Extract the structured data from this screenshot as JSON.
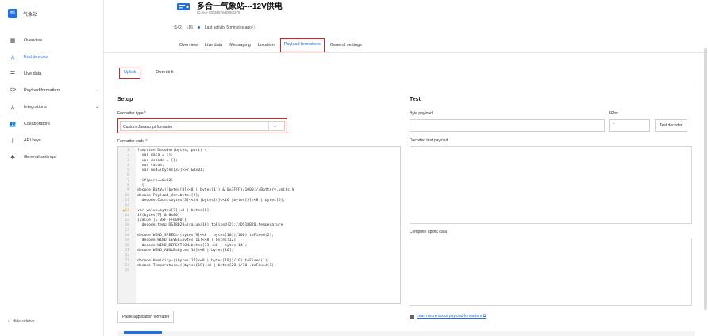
{
  "brand": {
    "name": "气象站"
  },
  "sidebar": {
    "items": [
      {
        "label": "Overview",
        "icon": "grid-icon",
        "glyph": "▦"
      },
      {
        "label": "End devices",
        "icon": "devices-icon",
        "glyph": "⅄"
      },
      {
        "label": "Live data",
        "icon": "list-icon",
        "glyph": "☰"
      },
      {
        "label": "Payload formatters",
        "icon": "code-icon",
        "glyph": "<>"
      },
      {
        "label": "Integrations",
        "icon": "integrations-icon",
        "glyph": "⅄"
      },
      {
        "label": "Collaborators",
        "icon": "people-icon",
        "glyph": "👥"
      },
      {
        "label": "API keys",
        "icon": "key-icon",
        "glyph": "⚷"
      },
      {
        "label": "General settings",
        "icon": "gear-icon",
        "glyph": "✱"
      }
    ],
    "hide_label": "Hide sidebar",
    "active_color": "#1f6fe5"
  },
  "device": {
    "title": "多合一气象站---12V供电",
    "id": "ID: eui-70b3d57ed0083378",
    "uplink_count": "142",
    "downlink_count": "16",
    "activity": "Last activity 5 minutes ago ⓘ"
  },
  "tabs": [
    "Overview",
    "Live data",
    "Messaging",
    "Location",
    "Payload formatters",
    "General settings"
  ],
  "subtabs": [
    "Uplink",
    "Downlink"
  ],
  "setup": {
    "title": "Setup",
    "formatter_type_label": "Formatter type",
    "formatter_type_value": "Custom Javascript formatter",
    "formatter_code_label": "Formatter code",
    "paste_button": "Paste application formatter"
  },
  "code": [
    {
      "n": "1",
      "t": "function Decoder(bytes, port) {"
    },
    {
      "n": "2",
      "t": "  var data = {};"
    },
    {
      "n": "3",
      "t": "  var decode = {};"
    },
    {
      "n": "4",
      "t": "  var value;"
    },
    {
      "n": "5",
      "t": "  var mod=(bytes[33]>>7)&0x01;"
    },
    {
      "n": "6",
      "t": ""
    },
    {
      "n": "7",
      "t": "  if(port==0x02)"
    },
    {
      "n": "8",
      "t": "  {"
    },
    {
      "n": "9",
      "t": "decode.BatV=((bytes[0]<<8 | bytes[1]) & 0x3FFF)/1000;//Battery,units:V"
    },
    {
      "n": "10",
      "t": "decode.Payload_Ver=bytes[2];"
    },
    {
      "n": "11",
      "t": "  decode.Count=bytes[3]<<24 |bytes[4]<<16 |bytes[5]<<8 | bytes[6];"
    },
    {
      "n": "12",
      "t": ""
    },
    {
      "n": "13",
      "t": "var value=bytes[7]<<8 | bytes[8];",
      "warn": true
    },
    {
      "n": "14",
      "t": "if(bytes[7] & 0x80)"
    },
    {
      "n": "15",
      "t": "{value |= 0xFFFF0000;}"
    },
    {
      "n": "16",
      "t": "  decode.temp_DS18B20=(value/10).toFixed(2);//DS18B20,temperature"
    },
    {
      "n": "17",
      "t": ""
    },
    {
      "n": "18",
      "t": "decode.WIND_SPEED=((bytes[9]<<8 | bytes[10])/100).toFixed(2);"
    },
    {
      "n": "19",
      "t": "  decode.WIND_LEVEL=bytes[11]<<8 | bytes[12];"
    },
    {
      "n": "20",
      "t": "  decode.WIND_DIRECTION=bytes[13]<<8 | bytes[14];"
    },
    {
      "n": "21",
      "t": "decode.WIND_ANGLE=bytes[15]<<8 | bytes[16];"
    },
    {
      "n": "22",
      "t": ""
    },
    {
      "n": "23",
      "t": "decode.Humidity=((bytes[17]<<8 | bytes[18])/10).toFixed(1);"
    },
    {
      "n": "24",
      "t": "decode.Temperature=((bytes[19]<<8 | bytes[20])/10).toFixed(1);"
    },
    {
      "n": "25",
      "t": ""
    }
  ],
  "test": {
    "title": "Test",
    "byte_payload_label": "Byte payload",
    "fport_label": "FPort",
    "fport_value": "1",
    "test_button": "Test decoder",
    "decoded_label": "Decoded test payload",
    "complete_label": "Complete uplink data",
    "learn_link": "Learn more about payload formatters ⧉"
  }
}
